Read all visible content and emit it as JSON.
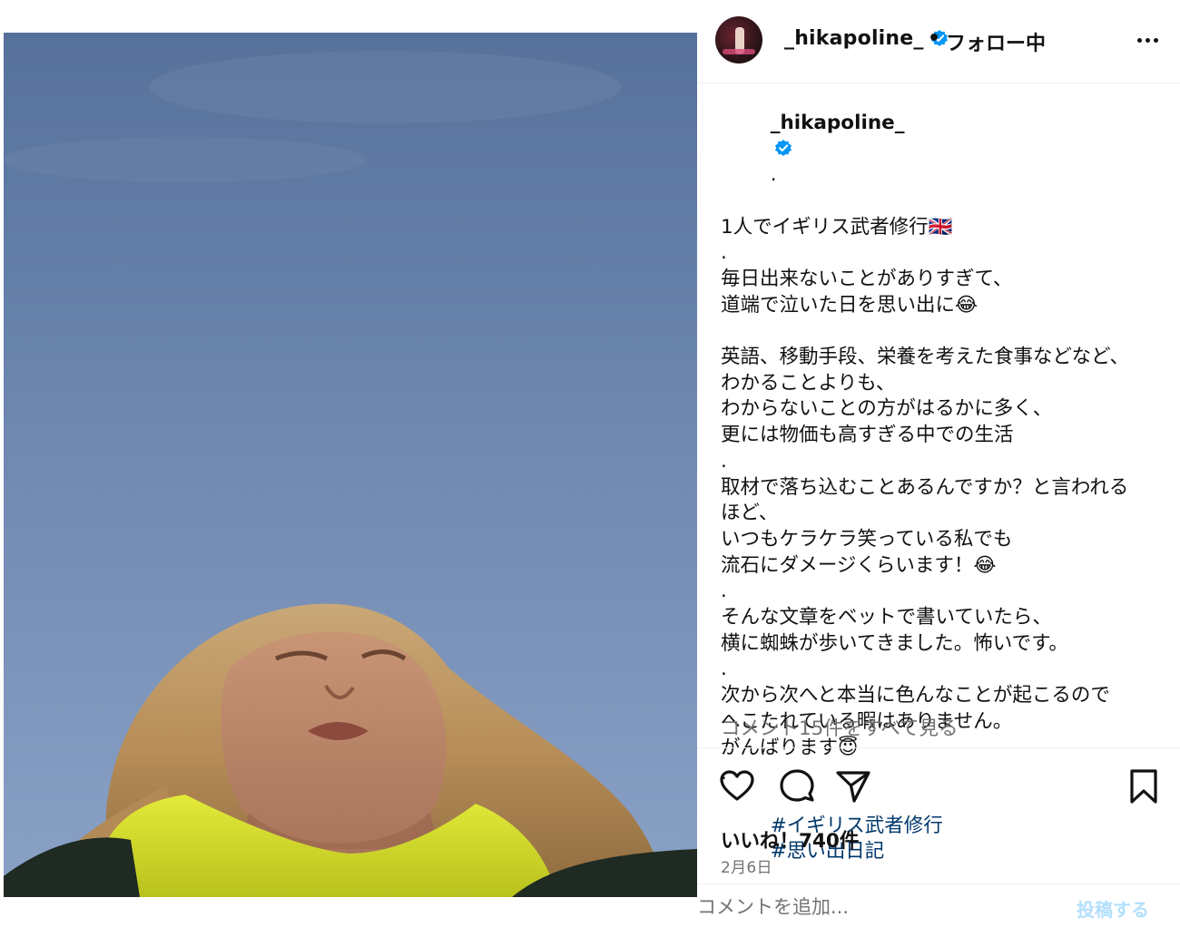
{
  "header": {
    "username": "_hikapoline_",
    "separator": "•",
    "follow_status": "フォロー中",
    "more_icon": "more-horizontal-icon"
  },
  "caption": {
    "username": "_hikapoline_",
    "suffix": ".",
    "lines": [
      "1人でイギリス武者修行🇬🇧",
      ".",
      "毎日出来ないことがありすぎて、",
      "道端で泣いた日を思い出に😂",
      "",
      "英語、移動手段、栄養を考えた食事などなど、",
      "わかることよりも、",
      "わからないことの方がはるかに多く、",
      "更には物価も高すぎる中での生活",
      ".",
      "取材で落ち込むことあるんですか？と言われる",
      "ほど、",
      "いつもケラケラ笑っている私でも",
      "流石にダメージくらいます！😂",
      ".",
      "そんな文章をベットで書いていたら、",
      "横に蜘蛛が歩いてきました。怖いです。",
      ".",
      "次から次へと本当に色んなことが起こるので",
      "へこたれている暇はありません。",
      "がんばります😇",
      "."
    ],
    "hashtags": [
      "#イギリス武者修行",
      "#思い出日記"
    ]
  },
  "view_comments": "コメント15件をすべて見る",
  "actions": {
    "like_icon": "heart-icon",
    "comment_icon": "comment-icon",
    "share_icon": "send-icon",
    "save_icon": "bookmark-icon"
  },
  "likes": "いいね！740件",
  "date": "2月6日",
  "comment": {
    "placeholder": "コメントを追加...",
    "post_label": "投稿する"
  },
  "colors": {
    "verified": "#0095f6",
    "hashtag": "#00376b",
    "muted": "#737373",
    "post_disabled": "#b2dffc"
  }
}
